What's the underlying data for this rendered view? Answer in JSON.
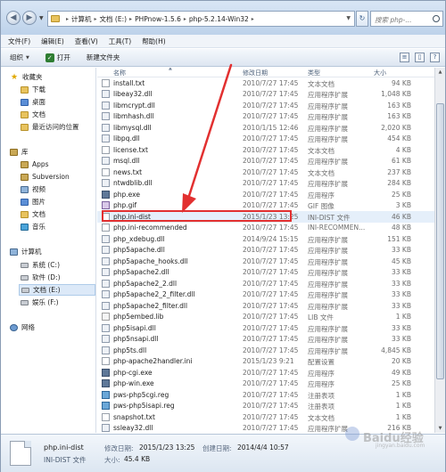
{
  "address": {
    "crumbs": [
      "计算机",
      "文档 (E:)",
      "PHPnow-1.5.6",
      "php-5.2.14-Win32"
    ],
    "search_placeholder": "搜索 php-..."
  },
  "menu": [
    "文件(F)",
    "编辑(E)",
    "查看(V)",
    "工具(T)",
    "帮助(H)"
  ],
  "toolbar": {
    "organize": "组织",
    "open": "打开",
    "new_folder": "新建文件夹"
  },
  "nav": {
    "favorites": "收藏夹",
    "downloads": "下载",
    "desktop": "桌面",
    "documents_fav": "文档",
    "recent": "最近访问的位置",
    "libraries": "库",
    "apps": "Apps",
    "subversion": "Subversion",
    "videos": "视频",
    "pictures": "图片",
    "documents": "文档",
    "music": "音乐",
    "computer": "计算机",
    "drive_c": "系统 (C:)",
    "drive_d": "软件 (D:)",
    "drive_e": "文档 (E:)",
    "drive_f": "娱乐 (F:)",
    "network": "网络"
  },
  "columns": {
    "name": "名称",
    "date": "修改日期",
    "type": "类型",
    "size": "大小"
  },
  "files": [
    {
      "name": "install.txt",
      "date": "2010/7/27 17:45",
      "type": "文本文档",
      "size": "94 KB",
      "kind": "txt"
    },
    {
      "name": "libeay32.dll",
      "date": "2010/7/27 17:45",
      "type": "应用程序扩展",
      "size": "1,048 KB",
      "kind": "dll"
    },
    {
      "name": "libmcrypt.dll",
      "date": "2010/7/27 17:45",
      "type": "应用程序扩展",
      "size": "163 KB",
      "kind": "dll"
    },
    {
      "name": "libmhash.dll",
      "date": "2010/7/27 17:45",
      "type": "应用程序扩展",
      "size": "163 KB",
      "kind": "dll"
    },
    {
      "name": "libmysql.dll",
      "date": "2010/1/15 12:46",
      "type": "应用程序扩展",
      "size": "2,020 KB",
      "kind": "dll"
    },
    {
      "name": "libpq.dll",
      "date": "2010/7/27 17:45",
      "type": "应用程序扩展",
      "size": "454 KB",
      "kind": "dll"
    },
    {
      "name": "license.txt",
      "date": "2010/7/27 17:45",
      "type": "文本文档",
      "size": "4 KB",
      "kind": "txt"
    },
    {
      "name": "msql.dll",
      "date": "2010/7/27 17:45",
      "type": "应用程序扩展",
      "size": "61 KB",
      "kind": "dll"
    },
    {
      "name": "news.txt",
      "date": "2010/7/27 17:45",
      "type": "文本文档",
      "size": "237 KB",
      "kind": "txt"
    },
    {
      "name": "ntwdblib.dll",
      "date": "2010/7/27 17:45",
      "type": "应用程序扩展",
      "size": "284 KB",
      "kind": "dll"
    },
    {
      "name": "php.exe",
      "date": "2010/7/27 17:45",
      "type": "应用程序",
      "size": "25 KB",
      "kind": "exe"
    },
    {
      "name": "php.gif",
      "date": "2010/7/27 17:45",
      "type": "GIF 图像",
      "size": "3 KB",
      "kind": "gif"
    },
    {
      "name": "php.ini-dist",
      "date": "2015/1/23 13:25",
      "type": "INI-DIST 文件",
      "size": "46 KB",
      "kind": "txt"
    },
    {
      "name": "php.ini-recommended",
      "date": "2010/7/27 17:45",
      "type": "INI-RECOMMEN...",
      "size": "48 KB",
      "kind": "txt"
    },
    {
      "name": "php_xdebug.dll",
      "date": "2014/9/24 15:15",
      "type": "应用程序扩展",
      "size": "151 KB",
      "kind": "dll"
    },
    {
      "name": "php5apache.dll",
      "date": "2010/7/27 17:45",
      "type": "应用程序扩展",
      "size": "33 KB",
      "kind": "dll"
    },
    {
      "name": "php5apache_hooks.dll",
      "date": "2010/7/27 17:45",
      "type": "应用程序扩展",
      "size": "45 KB",
      "kind": "dll"
    },
    {
      "name": "php5apache2.dll",
      "date": "2010/7/27 17:45",
      "type": "应用程序扩展",
      "size": "33 KB",
      "kind": "dll"
    },
    {
      "name": "php5apache2_2.dll",
      "date": "2010/7/27 17:45",
      "type": "应用程序扩展",
      "size": "33 KB",
      "kind": "dll"
    },
    {
      "name": "php5apache2_2_filter.dll",
      "date": "2010/7/27 17:45",
      "type": "应用程序扩展",
      "size": "33 KB",
      "kind": "dll"
    },
    {
      "name": "php5apache2_filter.dll",
      "date": "2010/7/27 17:45",
      "type": "应用程序扩展",
      "size": "33 KB",
      "kind": "dll"
    },
    {
      "name": "php5embed.lib",
      "date": "2010/7/27 17:45",
      "type": "LIB 文件",
      "size": "1 KB",
      "kind": "lib"
    },
    {
      "name": "php5isapi.dll",
      "date": "2010/7/27 17:45",
      "type": "应用程序扩展",
      "size": "33 KB",
      "kind": "dll"
    },
    {
      "name": "php5nsapi.dll",
      "date": "2010/7/27 17:45",
      "type": "应用程序扩展",
      "size": "33 KB",
      "kind": "dll"
    },
    {
      "name": "php5ts.dll",
      "date": "2010/7/27 17:45",
      "type": "应用程序扩展",
      "size": "4,845 KB",
      "kind": "dll"
    },
    {
      "name": "php-apache2handler.ini",
      "date": "2015/1/23 9:21",
      "type": "配置设置",
      "size": "20 KB",
      "kind": "txt"
    },
    {
      "name": "php-cgi.exe",
      "date": "2010/7/27 17:45",
      "type": "应用程序",
      "size": "49 KB",
      "kind": "exe"
    },
    {
      "name": "php-win.exe",
      "date": "2010/7/27 17:45",
      "type": "应用程序",
      "size": "25 KB",
      "kind": "exe"
    },
    {
      "name": "pws-php5cgi.reg",
      "date": "2010/7/27 17:45",
      "type": "注册表项",
      "size": "1 KB",
      "kind": "reg"
    },
    {
      "name": "pws-php5isapi.reg",
      "date": "2010/7/27 17:45",
      "type": "注册表项",
      "size": "1 KB",
      "kind": "reg"
    },
    {
      "name": "snapshot.txt",
      "date": "2010/7/27 17:45",
      "type": "文本文档",
      "size": "1 KB",
      "kind": "txt"
    },
    {
      "name": "ssleay32.dll",
      "date": "2010/7/27 17:45",
      "type": "应用程序扩展",
      "size": "216 KB",
      "kind": "dll"
    }
  ],
  "details": {
    "name": "php.ini-dist",
    "type": "INI-DIST 文件",
    "modified_label": "修改日期:",
    "modified_value": "2015/1/23 13:25",
    "created_label": "创建日期:",
    "created_value": "2014/4/4 10:57",
    "size_label": "大小:",
    "size_value": "45.4 KB"
  },
  "watermark": {
    "text": "Baidu经验",
    "sub": "jingyan.baidu.com"
  },
  "colors": {
    "highlight_border": "#e23030",
    "arrow": "#e23030"
  }
}
